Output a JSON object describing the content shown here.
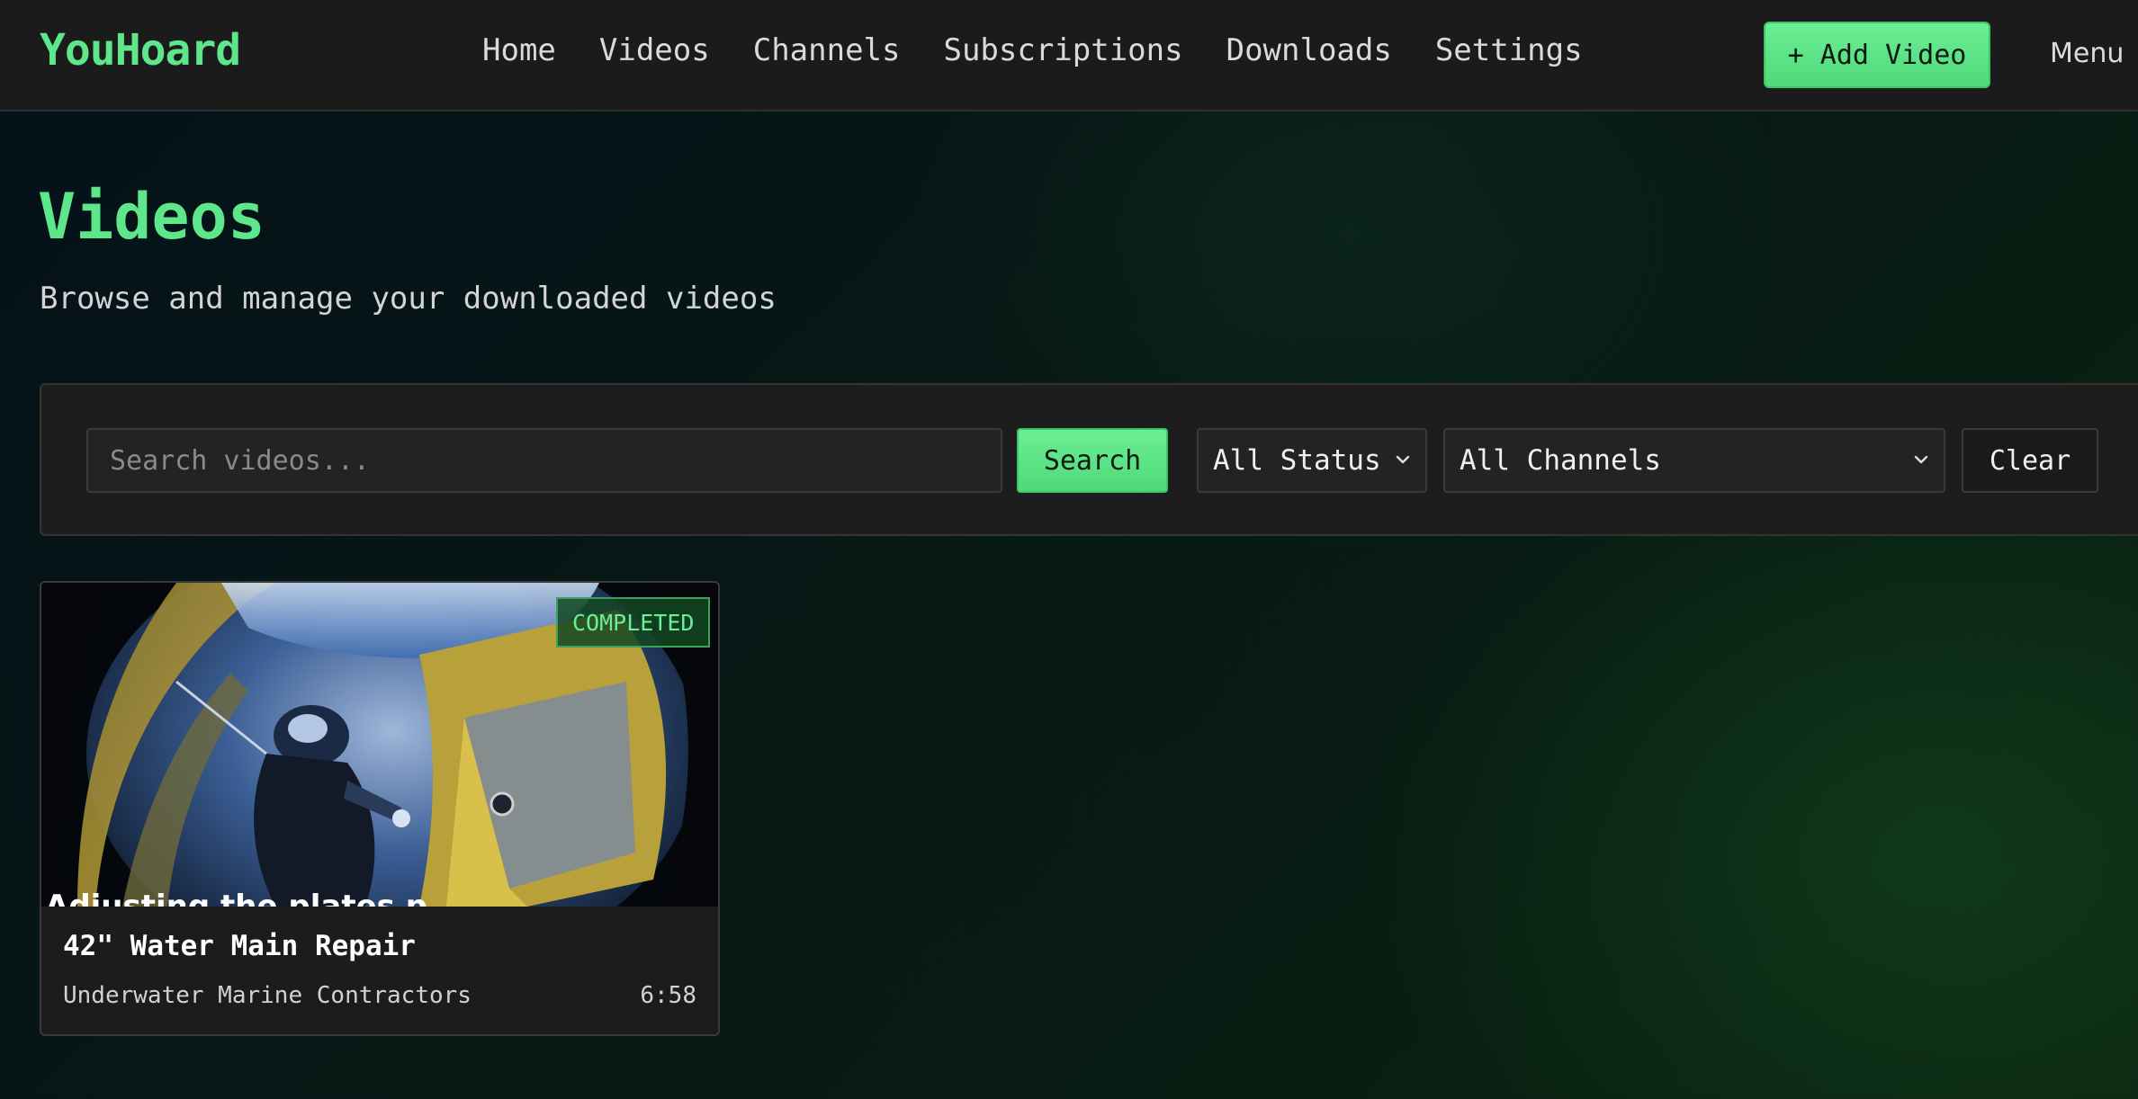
{
  "app": {
    "brand": "YouHoard"
  },
  "nav": {
    "items": [
      {
        "label": "Home"
      },
      {
        "label": "Videos"
      },
      {
        "label": "Channels"
      },
      {
        "label": "Subscriptions"
      },
      {
        "label": "Downloads"
      },
      {
        "label": "Settings"
      }
    ],
    "add_video_label": "+ Add Video",
    "menu_label": "Menu"
  },
  "page": {
    "title": "Videos",
    "subtitle": "Browse and manage your downloaded videos"
  },
  "filters": {
    "search_placeholder": "Search videos...",
    "search_value": "",
    "search_button": "Search",
    "status_selected": "All Status",
    "channel_selected": "All Channels",
    "clear_button": "Clear"
  },
  "videos": [
    {
      "title": "42\" Water Main Repair",
      "channel": "Underwater Marine Contractors",
      "duration": "6:58",
      "status": "COMPLETED",
      "caption": "Adjusting the plates p"
    }
  ],
  "colors": {
    "accent": "#5ee68a",
    "topbar_bg": "#1b1b1b",
    "panel_bg": "#1d1d1d",
    "status_completed": "#6cee96"
  },
  "icons": {
    "select_chevron": "chevron-down-icon"
  }
}
